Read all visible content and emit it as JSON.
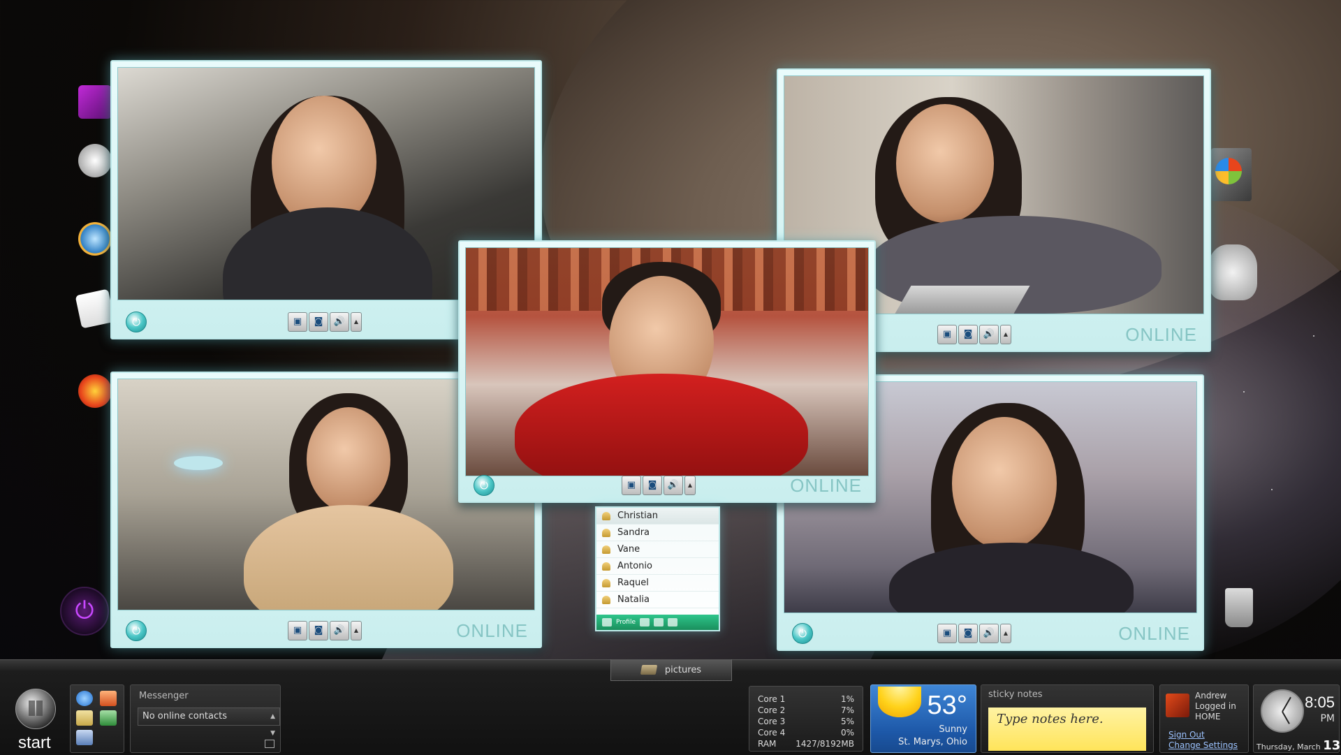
{
  "windows": {
    "top_left": {
      "status": ""
    },
    "top_right": {
      "status": "ONLINE"
    },
    "center": {
      "status": "ONLINE"
    },
    "bottom_left": {
      "status": "ONLINE"
    },
    "bottom_right": {
      "status": "ONLINE"
    }
  },
  "contacts": {
    "items": [
      "Christian",
      "Sandra",
      "Vane",
      "Antonio",
      "Raquel",
      "Natalia"
    ],
    "profile_label": "Profile"
  },
  "taskbar": {
    "pictures_label": "pictures",
    "start_label": "start",
    "messenger": {
      "title": "Messenger",
      "selected": "No online contacts"
    },
    "cpu": {
      "rows": [
        {
          "label": "Core 1",
          "value": "1%"
        },
        {
          "label": "Core 2",
          "value": "7%"
        },
        {
          "label": "Core 3",
          "value": "5%"
        },
        {
          "label": "Core 4",
          "value": "0%"
        },
        {
          "label": "RAM",
          "value": "1427/8192MB"
        }
      ]
    },
    "weather": {
      "temp": "53°",
      "condition": "Sunny",
      "location": "St. Marys, Ohio"
    },
    "sticky": {
      "title": "sticky notes",
      "placeholder": "Type notes here."
    },
    "user": {
      "name": "Andrew",
      "status_line1": "Logged in",
      "status_line2": "HOME",
      "sign_out": "Sign Out",
      "change_settings": "Change Settings"
    },
    "clock": {
      "time": "8:05",
      "ampm": "PM",
      "date": "Thursday, March",
      "day": "13"
    }
  },
  "colors": {
    "window_border": "#bfe9ea",
    "online_text": "#86c5c4",
    "contact_bar": "#1a8f5c",
    "weather_bg": "#1d58a8",
    "sticky_bg": "#ffe45a"
  }
}
